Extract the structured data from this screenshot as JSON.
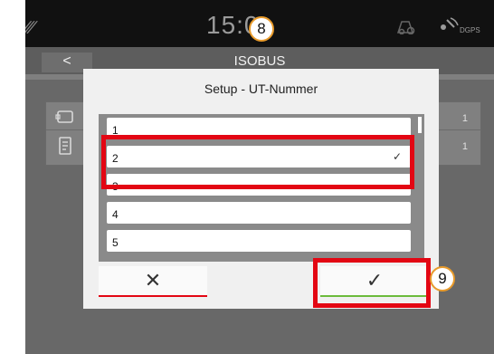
{
  "status_bar": {
    "time": "15:0",
    "gps_label": "DGPS"
  },
  "header": {
    "back_label": "<",
    "title": "ISOBUS"
  },
  "background_rows": [
    {
      "value": "1"
    },
    {
      "value": "1"
    }
  ],
  "dialog": {
    "title": "Setup - UT-Nummer",
    "items": [
      {
        "label": "1",
        "selected": false
      },
      {
        "label": "2",
        "selected": true,
        "check": "✓"
      },
      {
        "label": "3",
        "selected": false
      },
      {
        "label": "4",
        "selected": false
      },
      {
        "label": "5",
        "selected": false
      }
    ],
    "cancel_symbol": "✕",
    "confirm_symbol": "✓"
  },
  "callouts": {
    "time_step": "8",
    "confirm_step": "9"
  },
  "colors": {
    "highlight": "#e30613",
    "cancel_underline": "#e30613",
    "confirm_underline": "#6cbb3c",
    "callout_border": "#e89a2a"
  }
}
